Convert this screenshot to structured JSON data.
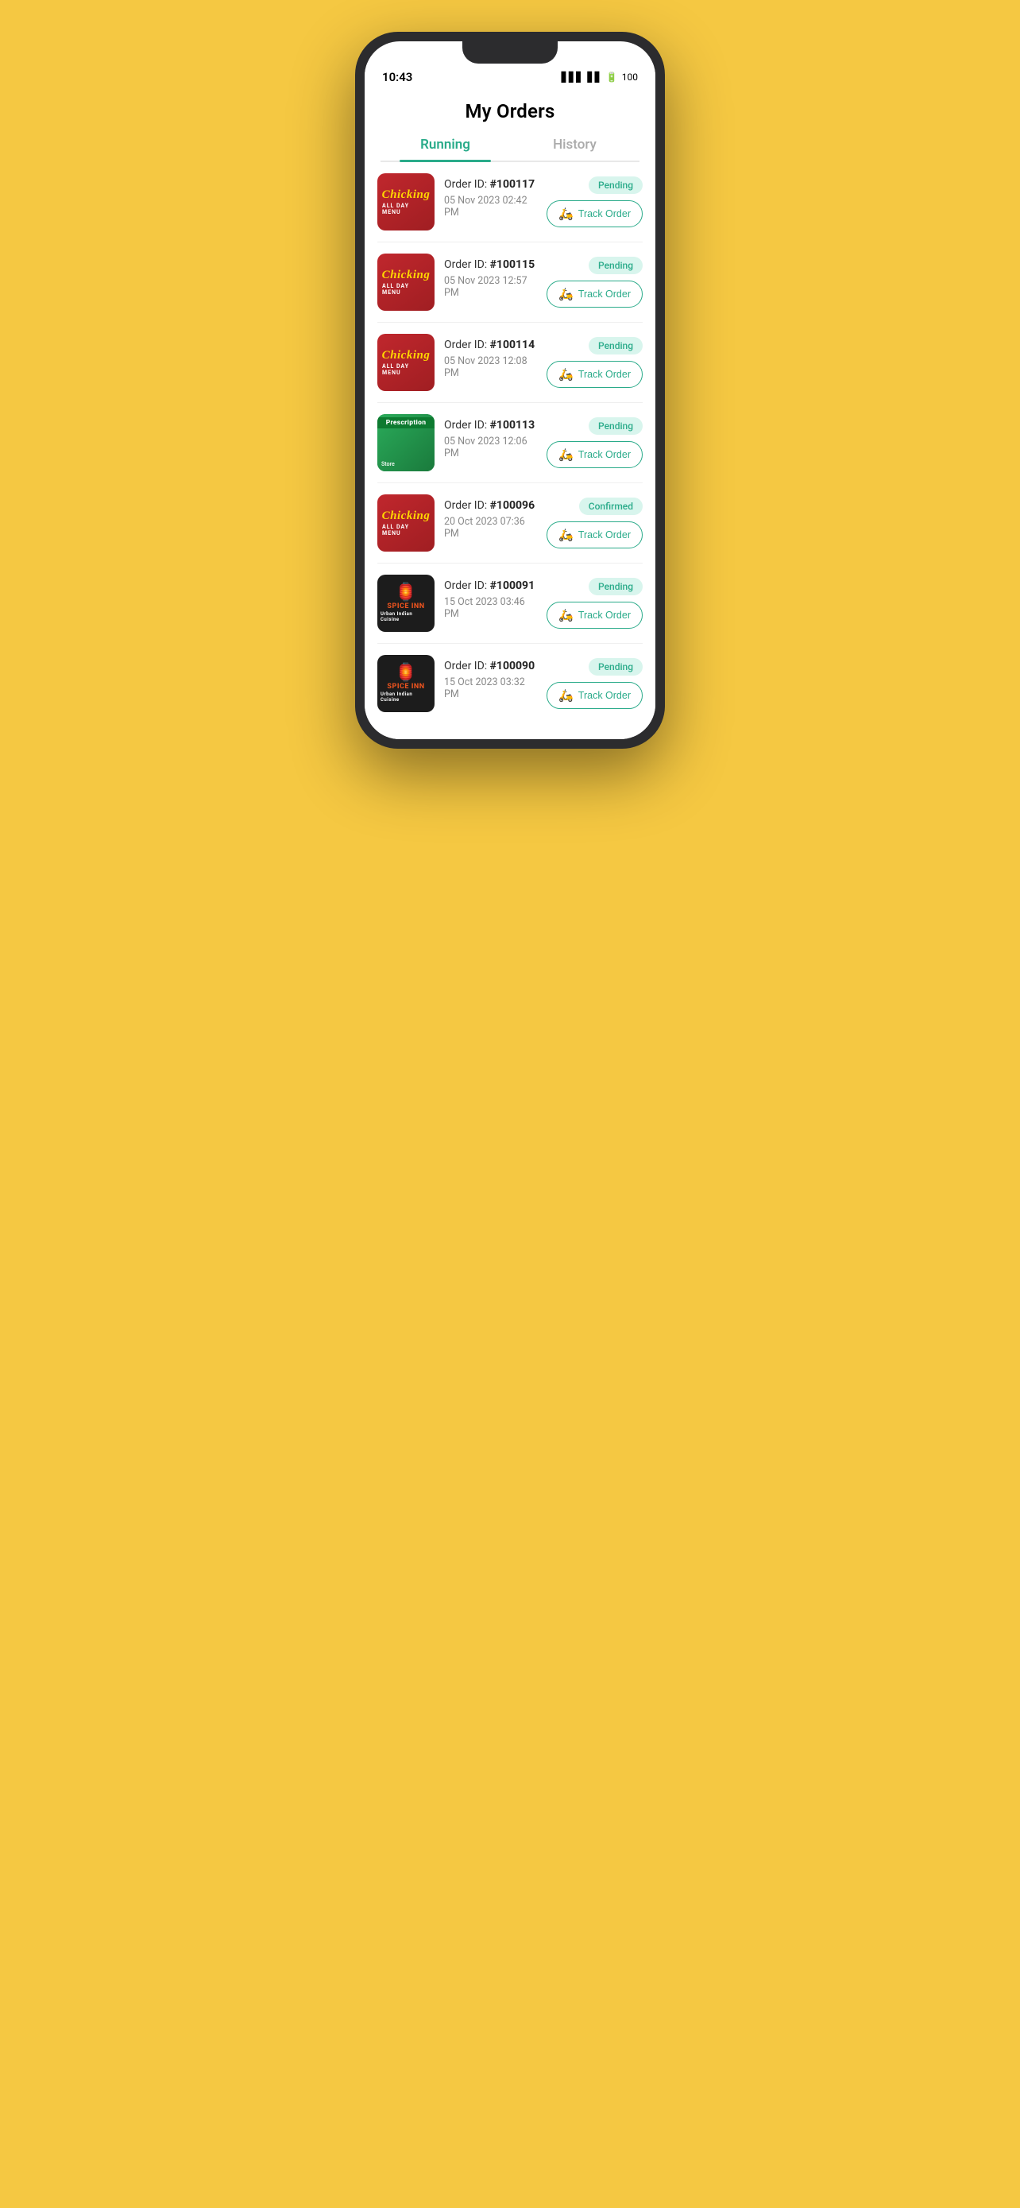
{
  "app": {
    "title": "My Orders",
    "status_time": "10:43",
    "status_battery": "100"
  },
  "tabs": [
    {
      "id": "running",
      "label": "Running",
      "active": true
    },
    {
      "id": "history",
      "label": "History",
      "active": false
    }
  ],
  "orders": [
    {
      "id": "order-100117",
      "order_id_label": "Order ID: ",
      "order_id_value": "#100117",
      "date": "05 Nov 2023  02:42 PM",
      "status": "Pending",
      "status_type": "pending",
      "restaurant": "chicking",
      "track_label": "Track Order"
    },
    {
      "id": "order-100115",
      "order_id_label": "Order ID: ",
      "order_id_value": "#100115",
      "date": "05 Nov 2023  12:57 PM",
      "status": "Pending",
      "status_type": "pending",
      "restaurant": "chicking",
      "track_label": "Track Order"
    },
    {
      "id": "order-100114",
      "order_id_label": "Order ID: ",
      "order_id_value": "#100114",
      "date": "05 Nov 2023  12:08 PM",
      "status": "Pending",
      "status_type": "pending",
      "restaurant": "chicking",
      "track_label": "Track Order"
    },
    {
      "id": "order-100113",
      "order_id_label": "Order ID: ",
      "order_id_value": "#100113",
      "date": "05 Nov 2023  12:06 PM",
      "status": "Pending",
      "status_type": "pending",
      "restaurant": "prescription",
      "track_label": "Track Order"
    },
    {
      "id": "order-100096",
      "order_id_label": "Order ID: ",
      "order_id_value": "#100096",
      "date": "20 Oct 2023  07:36 PM",
      "status": "Confirmed",
      "status_type": "confirmed",
      "restaurant": "chicking",
      "track_label": "Track Order"
    },
    {
      "id": "order-100091",
      "order_id_label": "Order ID: ",
      "order_id_value": "#100091",
      "date": "15 Oct 2023  03:46 PM",
      "status": "Pending",
      "status_type": "pending",
      "restaurant": "spiceinn",
      "track_label": "Track Order"
    },
    {
      "id": "order-100090",
      "order_id_label": "Order ID: ",
      "order_id_value": "#100090",
      "date": "15 Oct 2023  03:32 PM",
      "status": "Pending",
      "status_type": "pending",
      "restaurant": "spiceinn",
      "track_label": "Track Order"
    }
  ],
  "restaurant_labels": {
    "chicking": "Chicking",
    "prescription": "Prescription",
    "spiceinn": "SPICE INN Urban Cuisine"
  },
  "colors": {
    "accent": "#2AAB8A",
    "pending_bg": "#D8F5ED",
    "pending_text": "#2AAB8A",
    "confirmed_bg": "#D8F5ED",
    "confirmed_text": "#2AAB8A"
  }
}
